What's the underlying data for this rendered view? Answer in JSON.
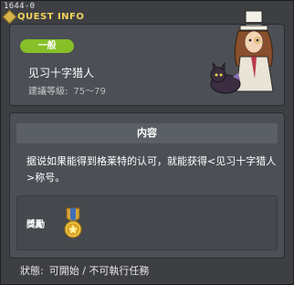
{
  "window": {
    "id_label": "1644-0",
    "title": "QUEST INFO"
  },
  "quest": {
    "category_badge": "一般",
    "name": "见习十字猎人",
    "level_label": "建議等級:",
    "level_range": "75～79"
  },
  "content": {
    "header": "内容",
    "description": "据说如果能得到格莱特的认可，就能获得<见习十字猎人>称号。"
  },
  "reward": {
    "label": "獎勵",
    "item_icon": "medal-icon"
  },
  "status": {
    "label": "狀態:",
    "value": "可開始 / 不可執行任務"
  },
  "colors": {
    "title": "#f3d35a",
    "badge": "#86bf28",
    "panel": "#4c4f55",
    "background": "#3d3f43"
  }
}
